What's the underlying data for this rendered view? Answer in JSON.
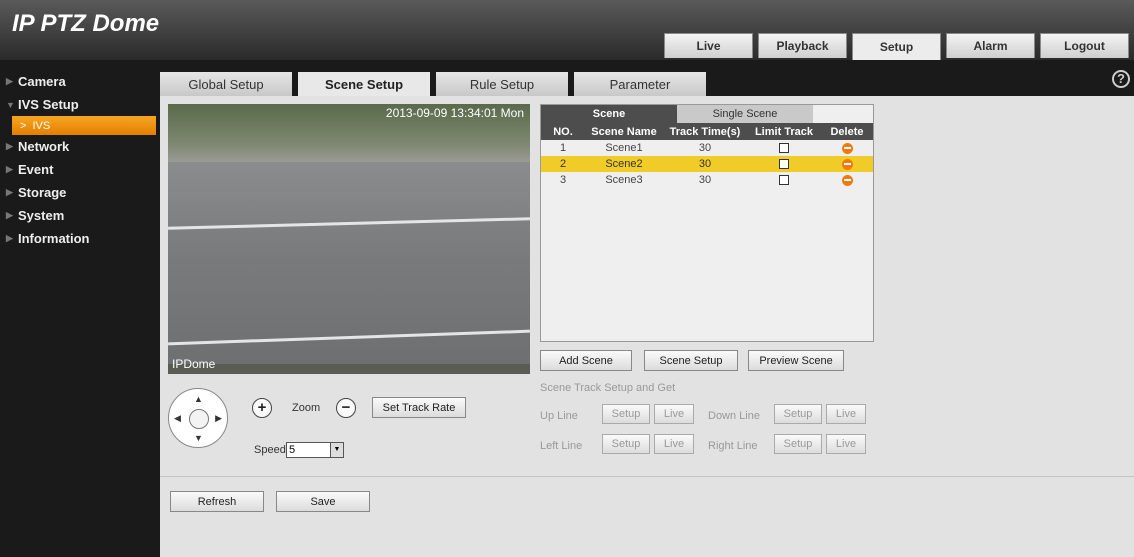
{
  "app": {
    "title": "IP PTZ Dome"
  },
  "top_nav": [
    "Live",
    "Playback",
    "Setup",
    "Alarm",
    "Logout"
  ],
  "top_nav_active": "Setup",
  "sidebar": {
    "items": [
      {
        "label": "Camera"
      },
      {
        "label": "IVS Setup"
      },
      {
        "label": "Network"
      },
      {
        "label": "Event"
      },
      {
        "label": "Storage"
      },
      {
        "label": "System"
      },
      {
        "label": "Information"
      }
    ],
    "sub_item": "IVS"
  },
  "sub_tabs": [
    "Global Setup",
    "Scene Setup",
    "Rule Setup",
    "Parameter"
  ],
  "sub_tabs_active": "Scene Setup",
  "help_icon": "?",
  "video": {
    "timestamp": "2013-09-09 13:34:01 Mon",
    "channel_name": "IPDome"
  },
  "scene_tabs": [
    "Scene",
    "Single Scene"
  ],
  "scene_table": {
    "headers": [
      "NO.",
      "Scene Name",
      "Track Time(s)",
      "Limit Track",
      "Delete"
    ],
    "rows": [
      {
        "no": "1",
        "name": "Scene1",
        "time": "30"
      },
      {
        "no": "2",
        "name": "Scene2",
        "time": "30"
      },
      {
        "no": "3",
        "name": "Scene3",
        "time": "30"
      }
    ],
    "selected_row": "2"
  },
  "scene_buttons": {
    "add": "Add Scene",
    "setup": "Scene Setup",
    "preview": "Preview Scene"
  },
  "track": {
    "title": "Scene Track Setup and Get",
    "up_line": "Up Line",
    "down_line": "Down Line",
    "left_line": "Left Line",
    "right_line": "Right Line",
    "setup_label": "Setup",
    "live_label": "Live"
  },
  "ptz": {
    "zoom_label": "Zoom",
    "zoom_in": "+",
    "zoom_out": "−",
    "set_track_rate": "Set Track Rate",
    "speed_label": "Speed",
    "speed_value": "5"
  },
  "footer": {
    "refresh": "Refresh",
    "save": "Save"
  },
  "colors": {
    "accent": "#f1cc28",
    "sidebar_active": "#f09a12",
    "delete_icon": "#f07a10",
    "table_header": "#4d4d4d"
  }
}
